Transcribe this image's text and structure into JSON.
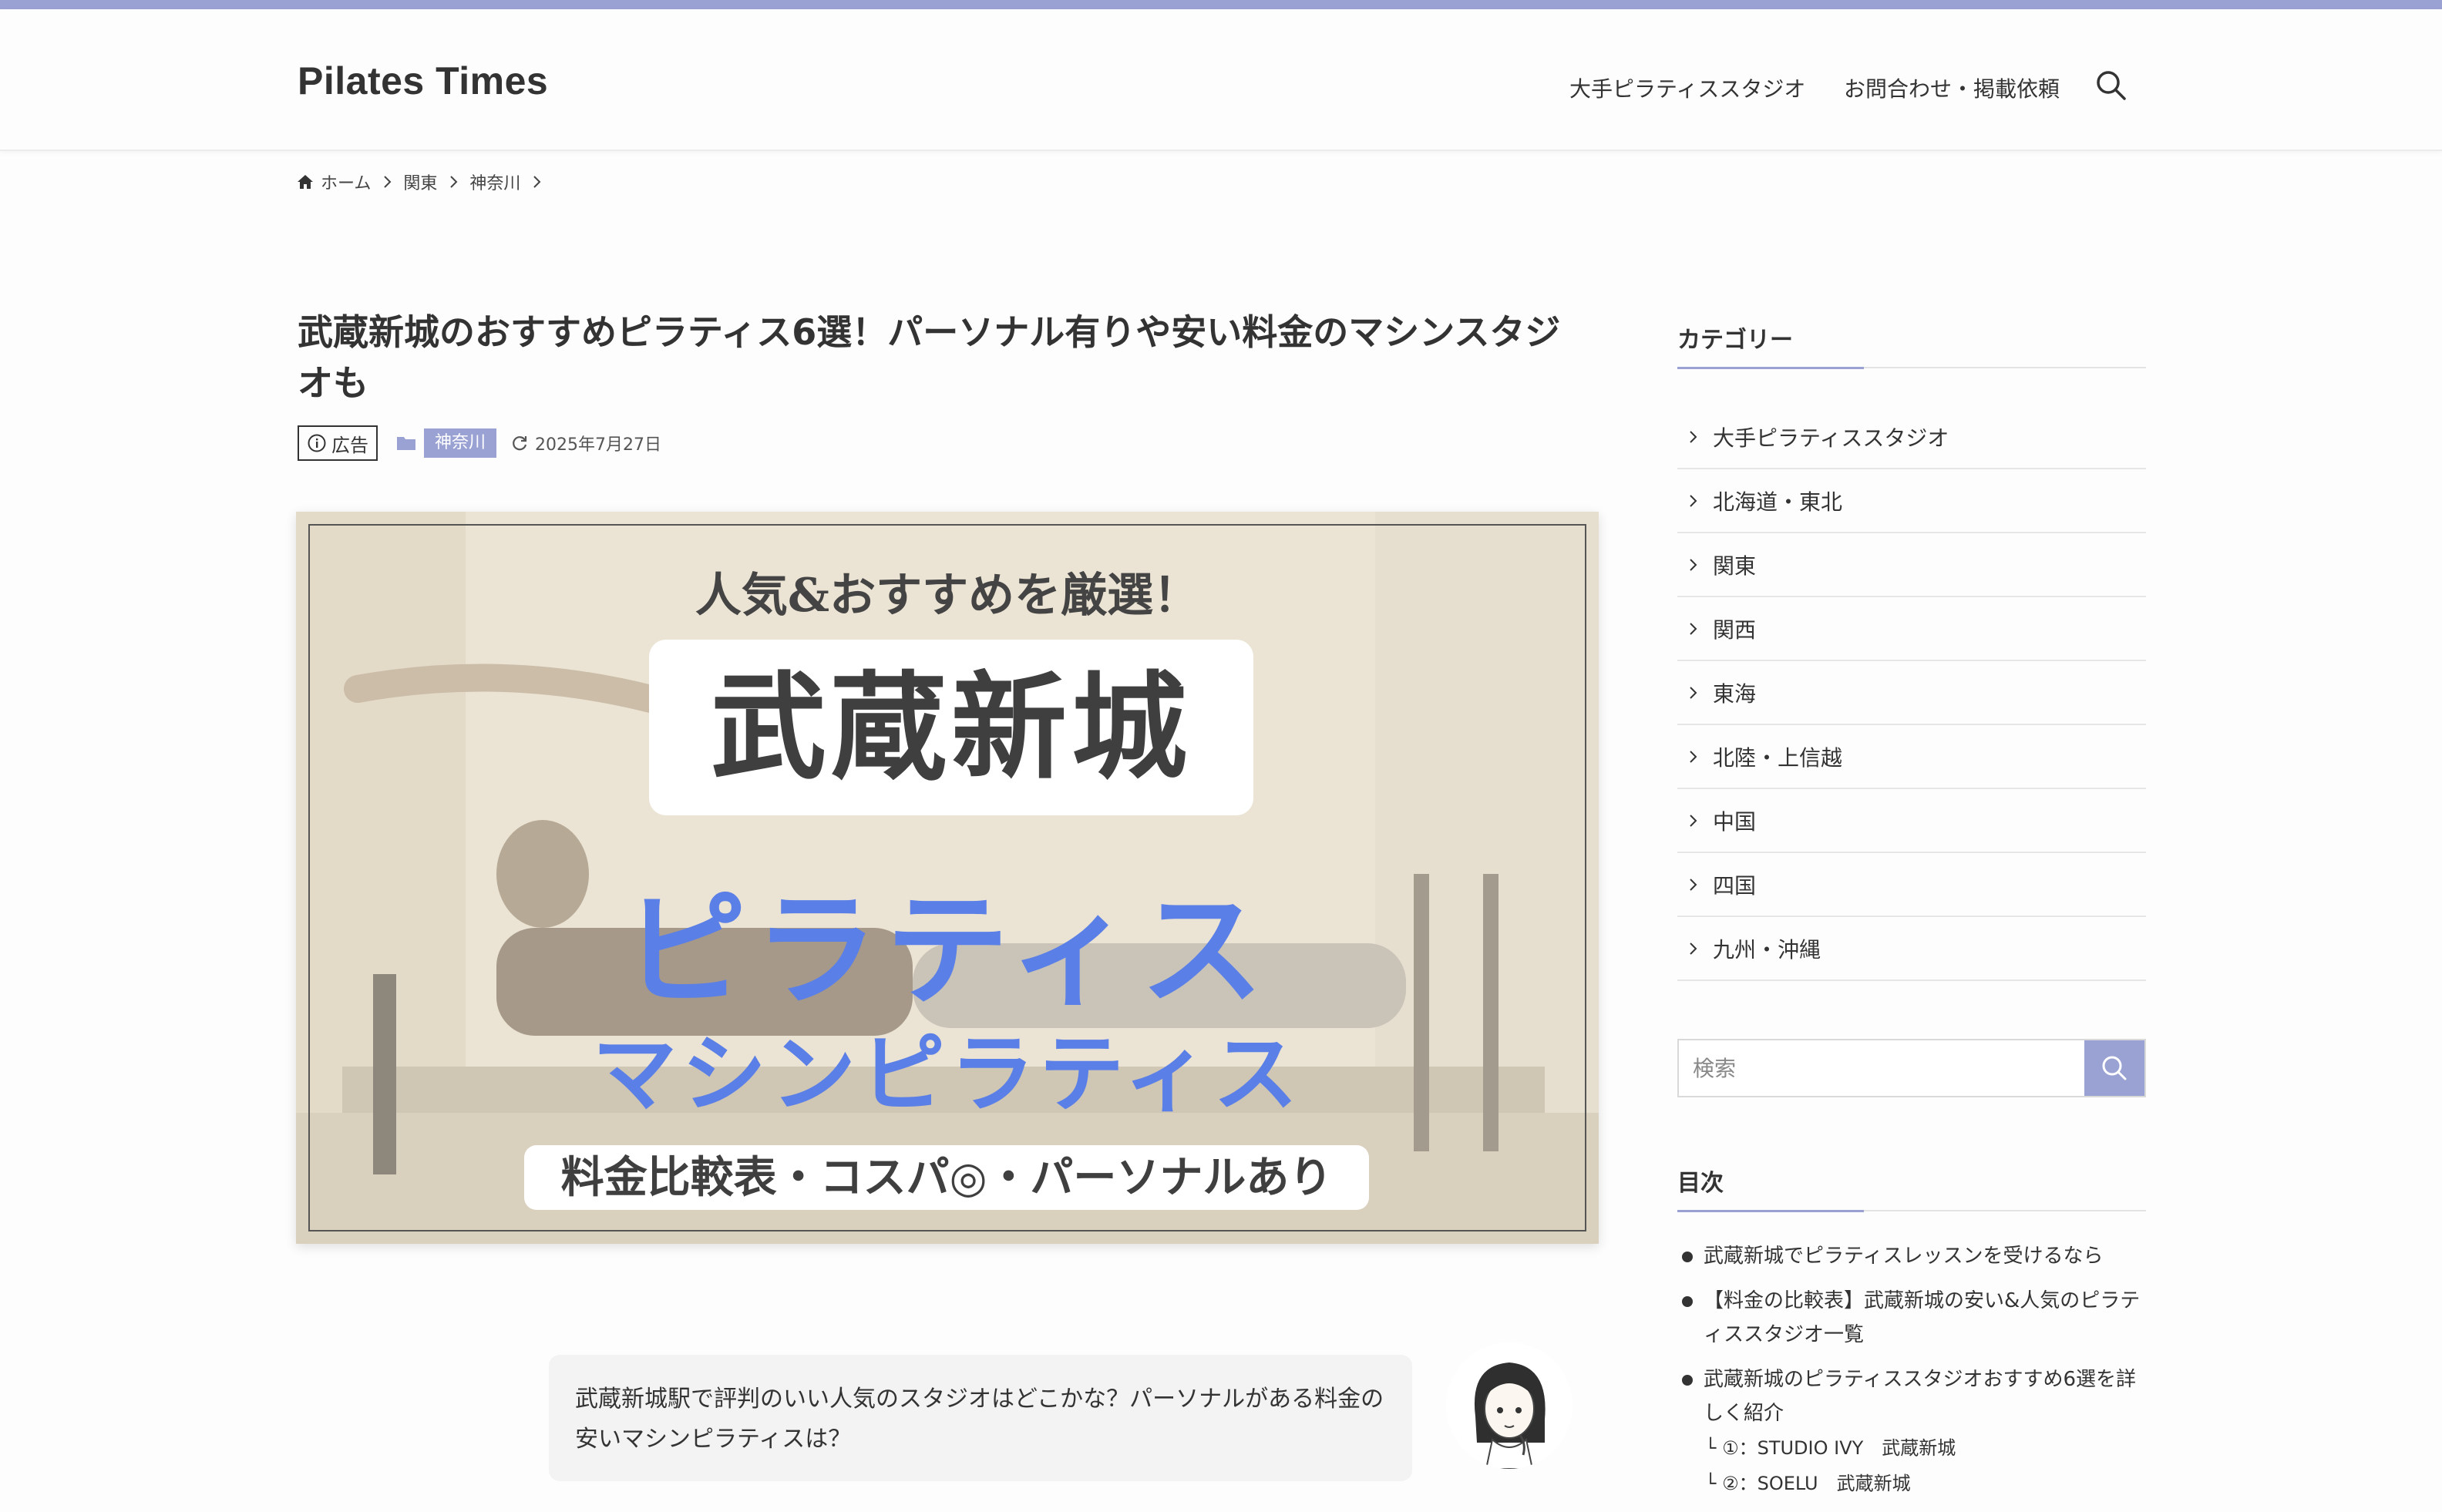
{
  "site": {
    "logo": "Pilates Times"
  },
  "nav": {
    "item1": "大手ピラティススタジオ",
    "item2": "お問合わせ・掲載依頼"
  },
  "breadcrumb": {
    "home": "ホーム",
    "level1": "関東",
    "level2": "神奈川"
  },
  "article": {
    "title": "武蔵新城のおすすめピラティス6選！パーソナル有りや安い料金のマシンスタジオも",
    "ad_label": "広告",
    "category": "神奈川",
    "date": "2025年7月27日"
  },
  "hero": {
    "subtitle": "人気&おすすめを厳選！",
    "city": "武蔵新城",
    "main": "ピラティス",
    "main2": "マシンピラティス",
    "bottom": "料金比較表・コスパ◎・パーソナルあり"
  },
  "bubble": {
    "text": "武蔵新城駅で評判のいい人気のスタジオはどこかな？パーソナルがある料金の安いマシンピラティスは？"
  },
  "sidebar": {
    "categories_heading": "カテゴリー",
    "categories": [
      "大手ピラティススタジオ",
      "北海道・東北",
      "関東",
      "関西",
      "東海",
      "北陸・上信越",
      "中国",
      "四国",
      "九州・沖縄"
    ],
    "search_placeholder": "検索",
    "toc_heading": "目次",
    "toc": [
      "武蔵新城でピラティスレッスンを受けるなら",
      "【料金の比較表】武蔵新城の安い&人気のピラティススタジオ一覧",
      "武蔵新城のピラティススタジオおすすめ6選を詳しく紹介"
    ],
    "toc_sub": [
      "└ ①：STUDIO IVY　武蔵新城",
      "└ ②：SOELU　武蔵新城"
    ]
  },
  "colors": {
    "accent": "#9aa2d4",
    "hero_blue": "#5a7fe6"
  },
  "icons": {
    "search": "search-icon",
    "home": "home-icon",
    "chevron": "chevron-right-icon",
    "folder": "folder-icon",
    "refresh": "refresh-icon",
    "info": "info-icon"
  }
}
